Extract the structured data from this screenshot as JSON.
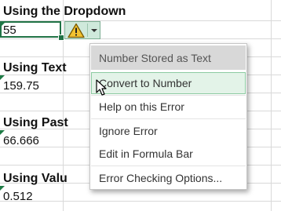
{
  "colors": {
    "selection_border": "#217346",
    "error_indicator": "#1e7b45",
    "error_button_bg": "#cfe9db",
    "warning_fill": "#f2c230",
    "menu_hover_bg": "#e3f3e8",
    "menu_title_bg": "#d8d8d8"
  },
  "sheet": {
    "sections": [
      {
        "heading": "Using the Dropdown",
        "value": "55"
      },
      {
        "heading": "Using Text",
        "value": "159.75"
      },
      {
        "heading": "Using Past",
        "value": "66.666"
      },
      {
        "heading": "Using Valu",
        "value": "0.512"
      }
    ]
  },
  "error_button": {
    "icon": "warning-icon",
    "dropdown_icon": "chevron-down-icon"
  },
  "menu": {
    "title": "Number Stored as Text",
    "items": [
      {
        "label": "Convert to Number",
        "hovered": true
      },
      {
        "label": "Help on this Error",
        "hovered": false
      },
      {
        "label": "Ignore Error",
        "hovered": false
      },
      {
        "label": "Edit in Formula Bar",
        "hovered": false
      },
      {
        "label": "Error Checking Options...",
        "hovered": false
      }
    ]
  }
}
